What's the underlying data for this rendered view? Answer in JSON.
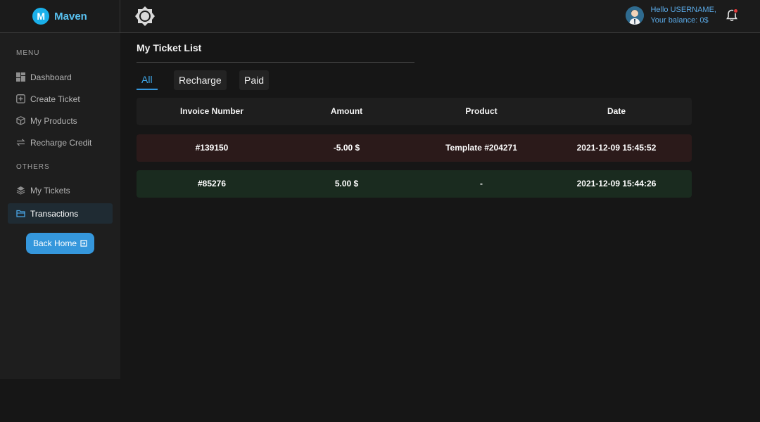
{
  "brand": {
    "logo_letter": "M",
    "name": "Maven"
  },
  "header": {
    "greeting": "Hello USERNAME,",
    "balance": "Your balance: 0$"
  },
  "sidebar": {
    "menu_title": "MENU",
    "menu_items": [
      {
        "label": "Dashboard",
        "icon": "dashboard-icon"
      },
      {
        "label": "Create Ticket",
        "icon": "plus-square-icon"
      },
      {
        "label": "My Products",
        "icon": "box-icon"
      },
      {
        "label": "Recharge Credit",
        "icon": "exchange-icon"
      }
    ],
    "others_title": "OTHERS",
    "other_items": [
      {
        "label": "My Tickets",
        "icon": "layers-icon"
      },
      {
        "label": "Transactions",
        "icon": "folder-icon",
        "active": true
      }
    ],
    "back_home": "Back Home"
  },
  "main": {
    "title": "My Ticket List",
    "tabs": [
      {
        "label": "All",
        "active": true
      },
      {
        "label": "Recharge",
        "active": false
      },
      {
        "label": "Paid",
        "active": false
      }
    ],
    "table": {
      "columns": [
        "Invoice Number",
        "Amount",
        "Product",
        "Date"
      ],
      "rows": [
        {
          "invoice": "#139150",
          "amount": "-5.00 $",
          "product": "Template #204271",
          "date": "2021-12-09 15:45:52",
          "type": "negative"
        },
        {
          "invoice": "#85276",
          "amount": "5.00 $",
          "product": "-",
          "date": "2021-12-09 15:44:26",
          "type": "positive"
        }
      ]
    }
  },
  "colors": {
    "accent": "#3597dc",
    "negative_row": "#2b1a1a",
    "positive_row": "#1a2b1f",
    "notification_dot": "#e23b3b"
  }
}
